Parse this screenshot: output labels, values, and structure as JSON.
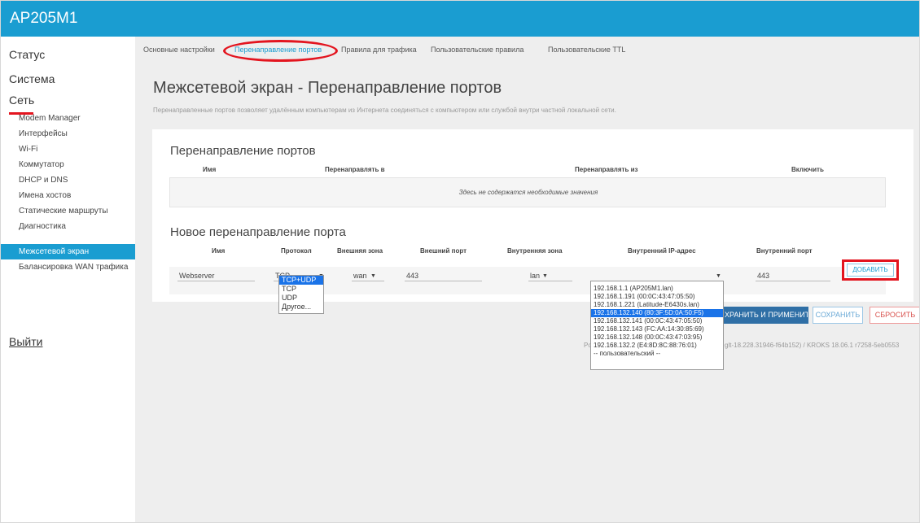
{
  "app": {
    "title": "AP205M1"
  },
  "sidebar": {
    "main": [
      "Статус",
      "Система",
      "Сеть"
    ],
    "sub": [
      "Modem Manager",
      "Интерфейсы",
      "Wi-Fi",
      "Коммутатор",
      "DHCP и DNS",
      "Имена хостов",
      "Статические маршруты",
      "Диагностика",
      "Межсетевой экран",
      "Балансировка WAN трафика"
    ],
    "active_sub": "Межсетевой экран",
    "logout": "Выйти"
  },
  "tabs": [
    "Основные настройки",
    "Перенаправление портов",
    "Правила для трафика",
    "Пользовательские правила",
    "Пользовательские TTL"
  ],
  "active_tab": "Перенаправление портов",
  "page": {
    "title": "Межсетевой экран - Перенаправление портов",
    "description": "Перенаправленные портов позволяет удалённым компьютерам из Интернета соединяться с компьютером или службой внутри частной локальной сети."
  },
  "forwards": {
    "title": "Перенаправление портов",
    "columns": [
      "Имя",
      "Перенаправлять в",
      "Перенаправлять из",
      "Включить"
    ],
    "empty_text": "Здесь не содержатся необходимые значения"
  },
  "new_forward": {
    "title": "Новое перенаправление порта",
    "columns": [
      "Имя",
      "Протокол",
      "Внешняя зона",
      "Внешний порт",
      "Внутренняя зона",
      "Внутренний IP-адрес",
      "Внутренний порт"
    ],
    "name_value": "Webserver",
    "protocol_value": "TCP",
    "ext_zone_value": "wan",
    "ext_port_value": "443",
    "int_zone_value": "lan",
    "int_ip_value": "",
    "int_port_value": "443",
    "add_label": "ДОБАВИТЬ"
  },
  "protocol_options": [
    "TCP+UDP",
    "TCP",
    "UDP",
    "Другое..."
  ],
  "protocol_highlighted": "TCP+UDP",
  "ip_options": [
    "192.168.1.1 (AP205M1.lan)",
    "192.168.1.191 (00:0C:43:47:05:50)",
    "192.168.1.221 (Latitude-E6430s.lan)",
    "192.168.132.140 (80:3F:5D:0A:50:F5)",
    "192.168.132.141 (00:0C:43:47:05:50)",
    "192.168.132.143 (FC:AA:14:30:85:69)",
    "192.168.132.148 (00:0C:43:47:03:95)",
    "192.168.132.2 (E4:8D:8C:88:76:01)",
    "-- пользовательский --"
  ],
  "ip_highlighted": "192.168.132.140 (80:3F:5D:0A:50:F5)",
  "actions": {
    "apply": "ХРАНИТЬ И ПРИМЕНИТЬ",
    "save": "СОХРАНИТЬ",
    "reset": "СБРОСИТЬ"
  },
  "footer": {
    "left": "Po",
    "right": "glt-18.228.31946-f64b152) / KROKS 18.06.1 r7258-5eb0553"
  },
  "colors": {
    "accent": "#1a9dd1",
    "highlight": "#1a73e8",
    "annotation_red": "#e3151f"
  }
}
